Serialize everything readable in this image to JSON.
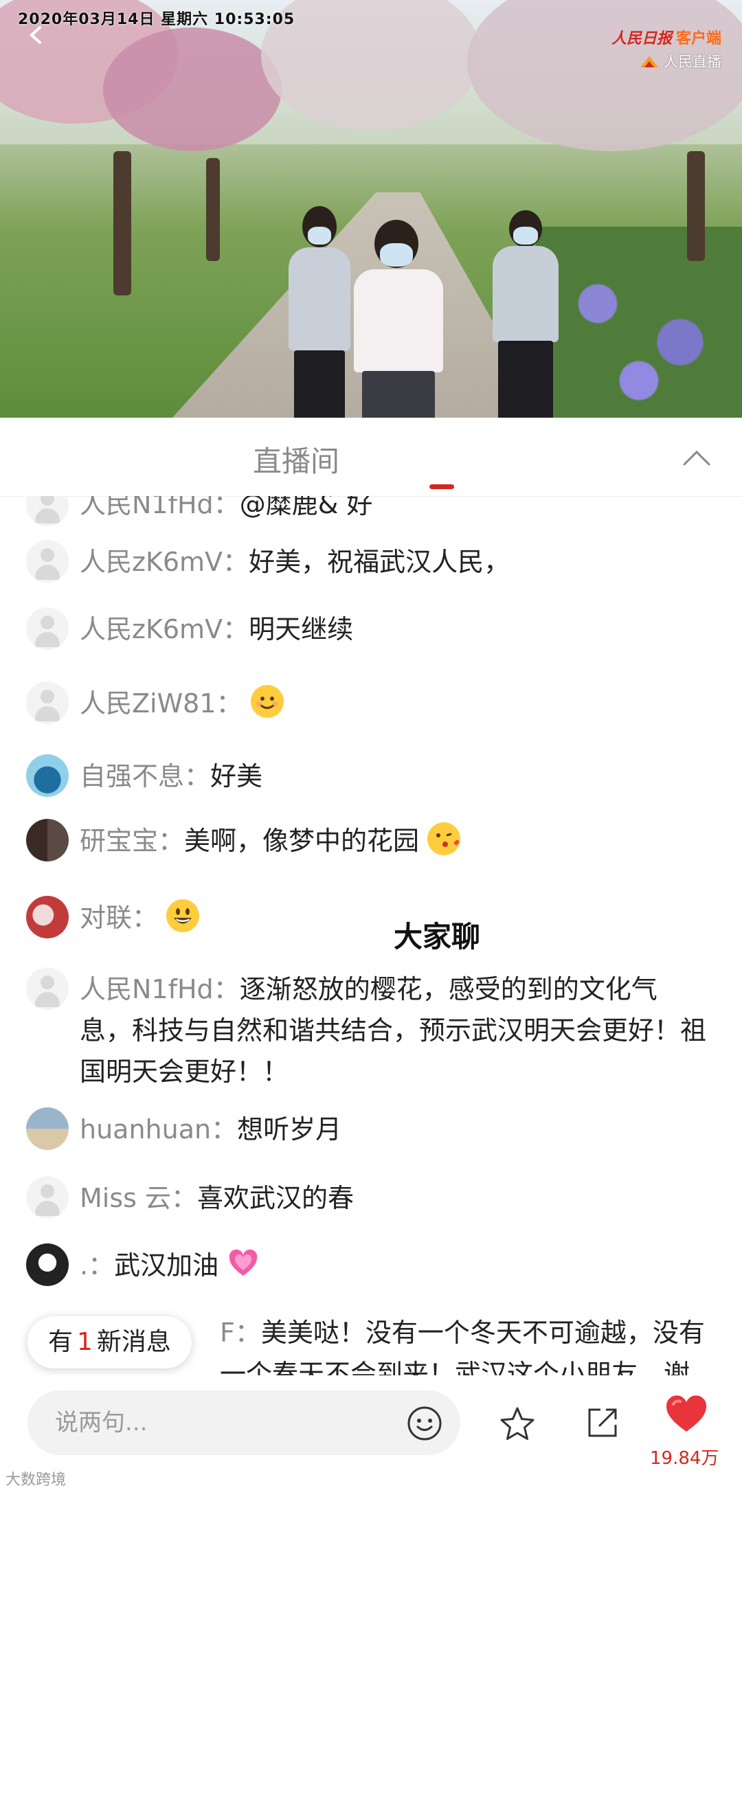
{
  "video": {
    "timestamp": "2020年03月14日  星期六  10:53:05",
    "brand_name": "人民日报",
    "brand_client": "客户端",
    "brand_live": "人民直播"
  },
  "tabs": {
    "live_room": "直播间",
    "chat": "大家聊"
  },
  "messages": [
    {
      "user": "人民N1fHd：",
      "text": "@糜鹿& 好"
    },
    {
      "user": "人民zK6mV：",
      "text": "好美，祝福武汉人民，"
    },
    {
      "user": "人民zK6mV：",
      "text": "明天继续"
    },
    {
      "user": "人民ZiW81：",
      "text": "",
      "emoji": "smiling-face"
    },
    {
      "user": "自强不息：",
      "text": "好美"
    },
    {
      "user": "研宝宝：",
      "text": "美啊，像梦中的花园",
      "emoji": "kissing-face"
    },
    {
      "user": "对联：",
      "text": "",
      "emoji": "grinning-face"
    },
    {
      "user": "人民N1fHd：",
      "text": "逐渐怒放的樱花，感受的到的文化气息，科技与自然和谐共结合，预示武汉明天会更好！祖国明天会更好！！"
    },
    {
      "user": "huanhuan：",
      "text": "想听岁月"
    },
    {
      "user": "Miss 云：",
      "text": "喜欢武汉的春"
    },
    {
      "user": ".：",
      "text": "武汉加油",
      "emoji": "sparkling-heart"
    },
    {
      "user": "F：",
      "text": "美美哒！没有一个冬天不可逾越，没有一个春天不会到来！武汉这个小朋友，谢谢"
    }
  ],
  "new_messages": {
    "prefix": "有",
    "count": "1",
    "suffix": "新消息"
  },
  "bottom_bar": {
    "input_placeholder": "说两句...",
    "likes": "19.84万"
  },
  "watermark": "大数跨境",
  "colors": {
    "accent": "#d7261e",
    "username": "#8a8a8a",
    "text": "#222222"
  }
}
